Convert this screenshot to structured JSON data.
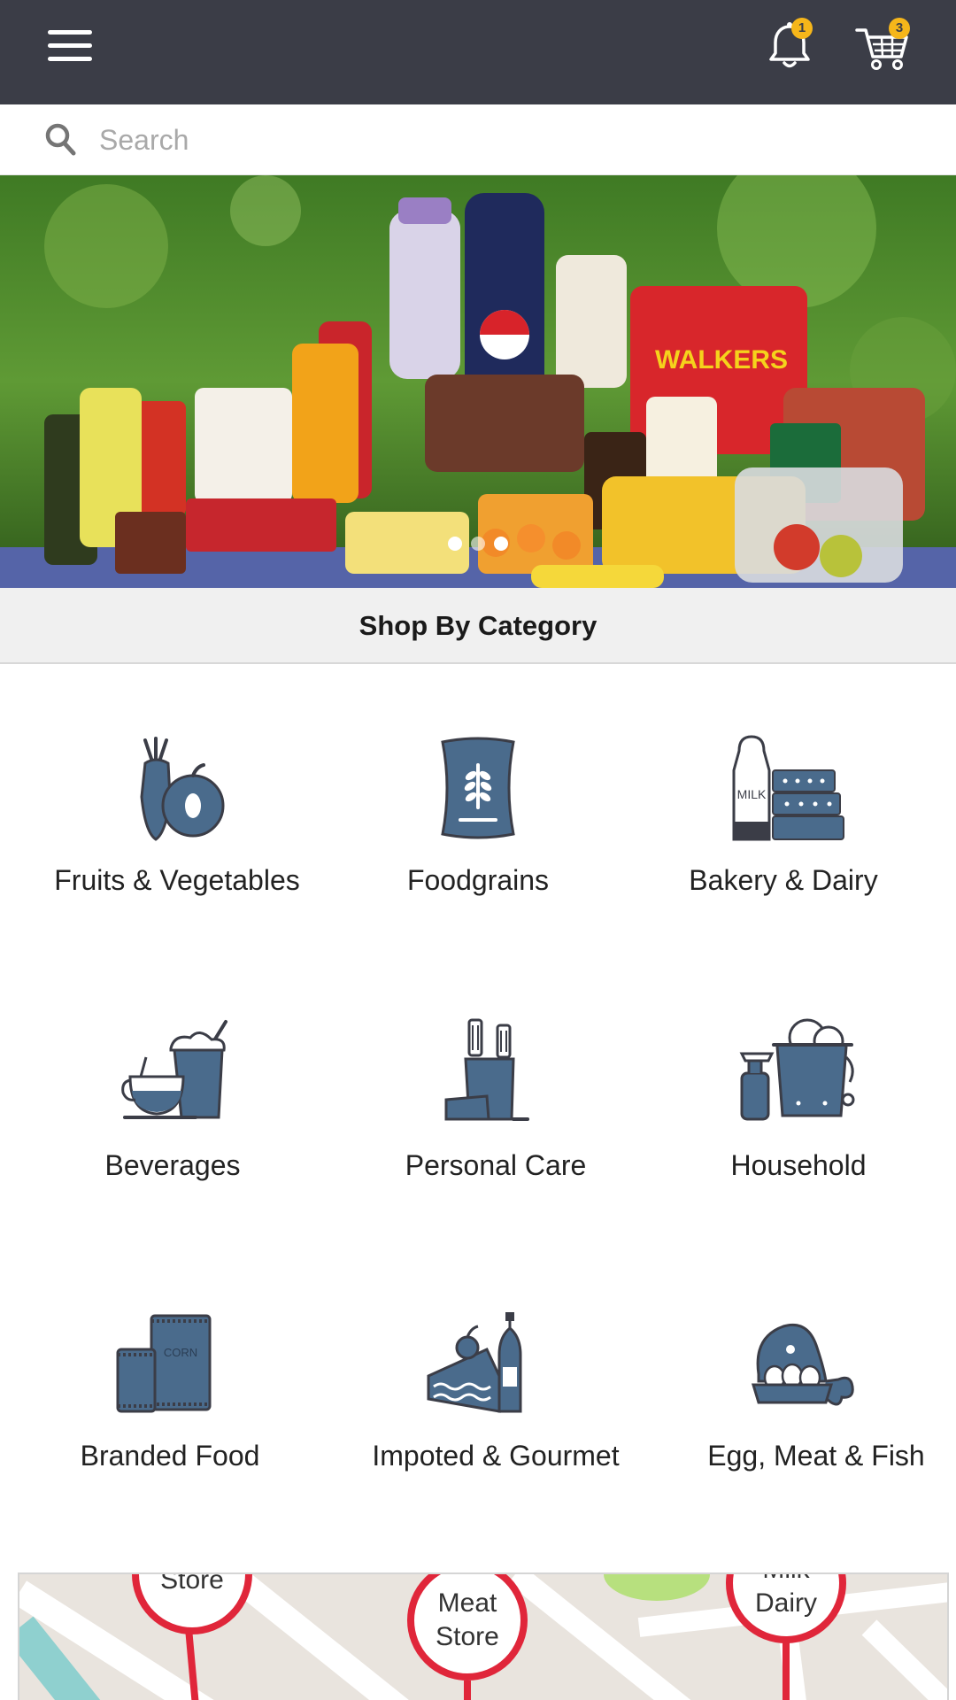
{
  "header": {
    "notification_count": "1",
    "cart_count": "3"
  },
  "search": {
    "placeholder": "Search"
  },
  "banner": {
    "slide_count": 3,
    "active_slide": 1
  },
  "category_section": {
    "title": "Shop By Category",
    "categories": [
      {
        "label": "Fruits & Vegetables",
        "icon": "fruits-vegetables-icon"
      },
      {
        "label": "Foodgrains",
        "icon": "foodgrains-icon"
      },
      {
        "label": "Bakery & Dairy",
        "icon": "bakery-dairy-icon",
        "icon_text": "MILK"
      },
      {
        "label": "Beverages",
        "icon": "beverages-icon"
      },
      {
        "label": "Personal Care",
        "icon": "personal-care-icon"
      },
      {
        "label": "Household",
        "icon": "household-icon"
      },
      {
        "label": "Branded Food",
        "icon": "branded-food-icon",
        "icon_text": "CORN"
      },
      {
        "label": "Impoted & Gourmet",
        "icon": "imported-gourmet-icon"
      },
      {
        "label": "Egg, Meat & Fish",
        "icon": "egg-meat-fish-icon"
      }
    ]
  },
  "map": {
    "pins": [
      {
        "label": "Store"
      },
      {
        "label": "Meat Store"
      },
      {
        "label": "Milk Dairy"
      }
    ]
  },
  "colors": {
    "appbar": "#3b3d47",
    "badge": "#f6b61a",
    "icon_blue": "#4a6b8c",
    "icon_dark": "#3b3d47",
    "pin_red": "#e0263a"
  }
}
